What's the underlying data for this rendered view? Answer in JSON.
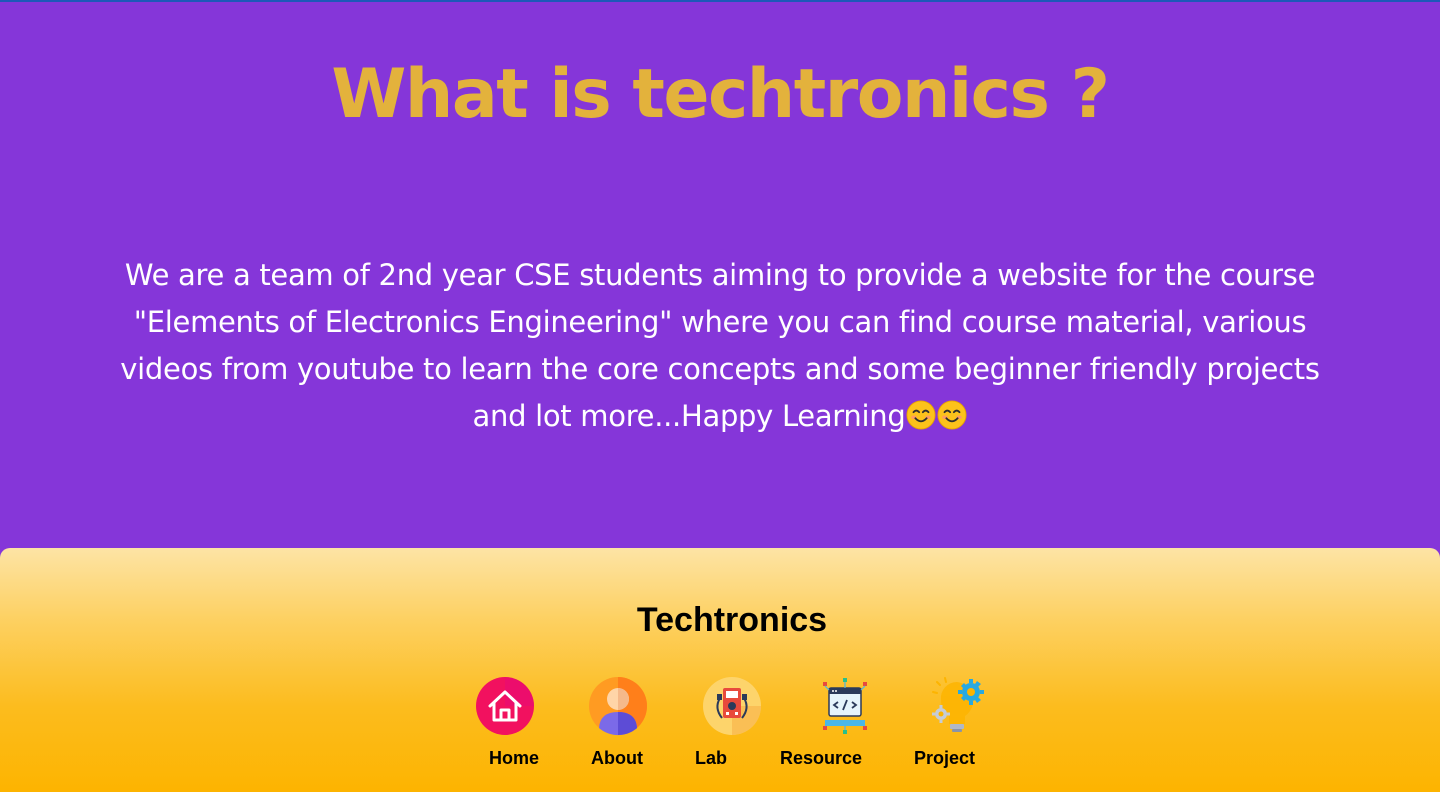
{
  "hero": {
    "title": "What is techtronics ?",
    "description": "We are a team of 2nd year CSE students aiming to provide a website for the course \"Elements of Electronics Engineering\" where you can find course material, various videos from youtube to learn the core concepts and some beginner friendly projects and lot more...Happy Learning",
    "emoji_icons": [
      "smiling-face-icon",
      "smiling-face-icon"
    ]
  },
  "footer": {
    "title": "Techtronics",
    "nav": [
      {
        "label": "Home",
        "icon": "home-icon"
      },
      {
        "label": "About",
        "icon": "user-icon"
      },
      {
        "label": "Lab",
        "icon": "lab-icon"
      },
      {
        "label": "Resource",
        "icon": "code-window-icon"
      },
      {
        "label": "Project",
        "icon": "lightbulb-gear-icon"
      }
    ]
  },
  "colors": {
    "background": "#8536d9",
    "title": "#e3b23c",
    "footer_gradient_top": "#fde4a5",
    "footer_gradient_bottom": "#fdb400"
  }
}
